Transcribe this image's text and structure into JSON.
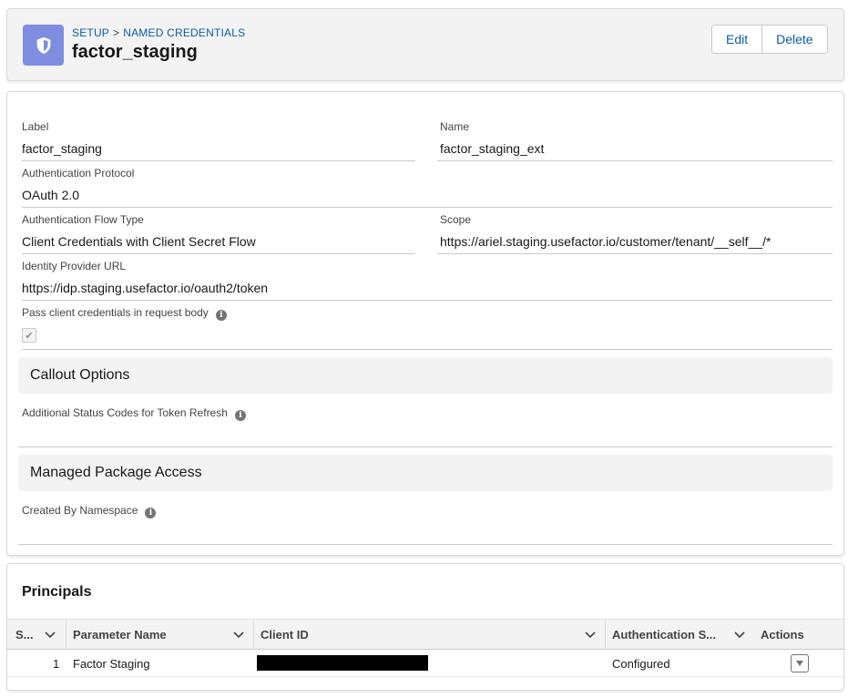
{
  "header": {
    "breadcrumb_root": "SETUP",
    "breadcrumb_sep": ">",
    "breadcrumb_section": "NAMED CREDENTIALS",
    "title": "factor_staging",
    "icon": "shield-icon",
    "edit_label": "Edit",
    "delete_label": "Delete"
  },
  "details": {
    "label_label": "Label",
    "label_value": "factor_staging",
    "name_label": "Name",
    "name_value": "factor_staging_ext",
    "auth_protocol_label": "Authentication Protocol",
    "auth_protocol_value": "OAuth 2.0",
    "auth_flow_label": "Authentication Flow Type",
    "auth_flow_value": "Client Credentials with Client Secret Flow",
    "scope_label": "Scope",
    "scope_value": "https://ariel.staging.usefactor.io/customer/tenant/__self__/*",
    "idp_url_label": "Identity Provider URL",
    "idp_url_value": "https://idp.staging.usefactor.io/oauth2/token",
    "pass_creds_label": "Pass client credentials in request body",
    "pass_creds_checked": true
  },
  "callout": {
    "section_title": "Callout Options",
    "status_codes_label": "Additional Status Codes for Token Refresh"
  },
  "managed_package": {
    "section_title": "Managed Package Access",
    "namespace_label": "Created By Namespace"
  },
  "principals": {
    "title": "Principals",
    "columns": [
      "S...",
      "Parameter Name",
      "Client ID",
      "Authentication S...",
      "Actions"
    ],
    "rows": [
      {
        "seq": "1",
        "parameter_name": "Factor Staging",
        "client_id": "",
        "auth_status": "Configured"
      }
    ]
  },
  "colors": {
    "accent": "#0b5cab",
    "icon_bg": "#7f8de1",
    "section_bg": "#f3f3f3"
  }
}
